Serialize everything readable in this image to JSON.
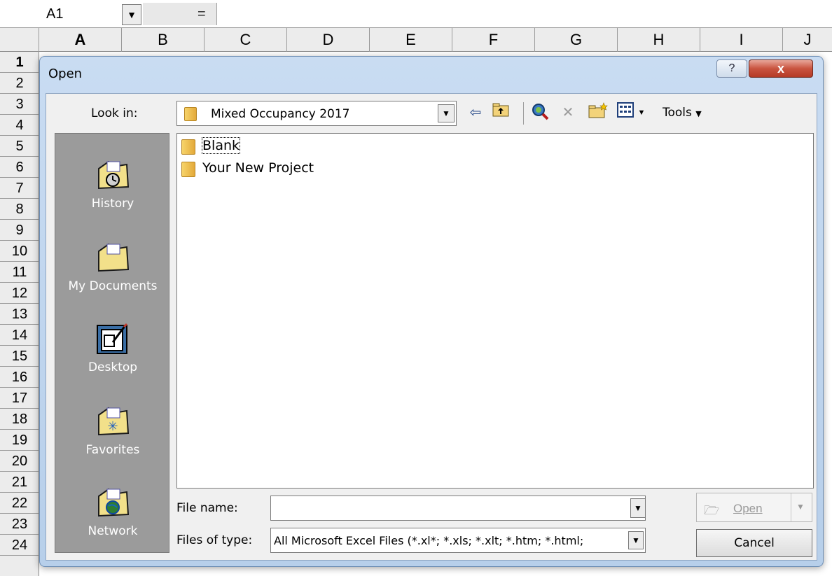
{
  "sheet": {
    "name_box": "A1",
    "formula_equals": "=",
    "columns": [
      "A",
      "B",
      "C",
      "D",
      "E",
      "F",
      "G",
      "H",
      "I",
      "J"
    ],
    "rows": [
      "1",
      "2",
      "3",
      "4",
      "5",
      "6",
      "7",
      "8",
      "9",
      "10",
      "11",
      "12",
      "13",
      "14",
      "15",
      "16",
      "17",
      "18",
      "19",
      "20",
      "21",
      "22",
      "23",
      "24"
    ]
  },
  "dialog": {
    "title": "Open",
    "help_label": "?",
    "close_label": "x",
    "look_in_label": "Look in:",
    "look_in_value": "Mixed Occupancy 2017",
    "tools_label": "Tools",
    "places": [
      {
        "label": "History",
        "icon": "history-folder-icon"
      },
      {
        "label": "My Documents",
        "icon": "documents-folder-icon"
      },
      {
        "label": "Desktop",
        "icon": "desktop-icon"
      },
      {
        "label": "Favorites",
        "icon": "favorites-folder-icon"
      },
      {
        "label": "Network",
        "icon": "network-folder-icon"
      }
    ],
    "files": [
      {
        "name": "Blank"
      },
      {
        "name": "Your New Project"
      }
    ],
    "file_name_label": "File name:",
    "file_name_value": "",
    "file_type_label": "Files of type:",
    "file_type_value": "All Microsoft Excel Files (*.xl*; *.xls; *.xlt; *.htm; *.html;",
    "open_label": "Open",
    "cancel_label": "Cancel"
  },
  "colors": {
    "places_bar": "#9b9b9b",
    "title_bar": "#c9dcf2",
    "close_button": "#c9543f"
  }
}
